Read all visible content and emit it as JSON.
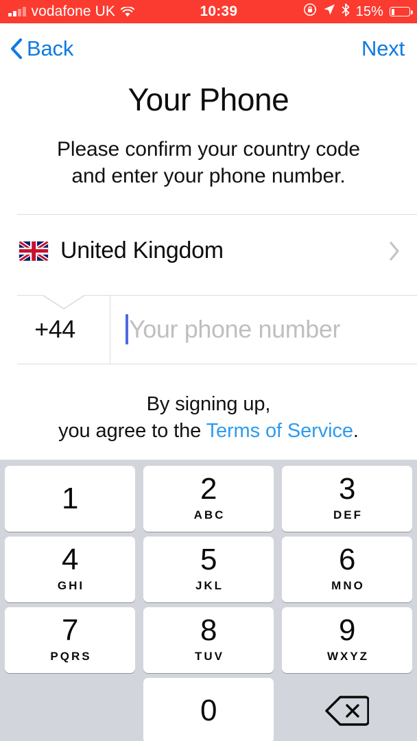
{
  "status_bar": {
    "carrier": "vodafone UK",
    "time": "10:39",
    "battery_percent": "15%",
    "icons": [
      "signal-bars-icon",
      "wifi-icon",
      "rotation-lock-icon",
      "location-arrow-icon",
      "bluetooth-icon",
      "battery-icon"
    ],
    "background_color": "#FB3B30"
  },
  "nav": {
    "back_label": "Back",
    "next_label": "Next",
    "accent_color": "#107AE0"
  },
  "header": {
    "title": "Your Phone",
    "subtitle_line1": "Please confirm your country code",
    "subtitle_line2": "and enter your phone number."
  },
  "country": {
    "flag": "united-kingdom-flag",
    "name": "United Kingdom"
  },
  "phone": {
    "country_code": "+44",
    "placeholder": "Your phone number",
    "value": "",
    "caret_color": "#4E6AE0"
  },
  "terms": {
    "line1": "By signing up,",
    "line2_prefix": "you agree to the ",
    "link_label": "Terms of Service",
    "line2_suffix": ".",
    "link_color": "#2E9BEE"
  },
  "keypad": {
    "background_color": "#D2D5DB",
    "rows": [
      [
        {
          "num": "1",
          "sub": ""
        },
        {
          "num": "2",
          "sub": "ABC"
        },
        {
          "num": "3",
          "sub": "DEF"
        }
      ],
      [
        {
          "num": "4",
          "sub": "GHI"
        },
        {
          "num": "5",
          "sub": "JKL"
        },
        {
          "num": "6",
          "sub": "MNO"
        }
      ],
      [
        {
          "num": "7",
          "sub": "PQRS"
        },
        {
          "num": "8",
          "sub": "TUV"
        },
        {
          "num": "9",
          "sub": "WXYZ"
        }
      ],
      [
        {
          "num": "",
          "sub": ""
        },
        {
          "num": "0",
          "sub": ""
        },
        {
          "num": "delete-key-icon",
          "sub": ""
        }
      ]
    ]
  }
}
